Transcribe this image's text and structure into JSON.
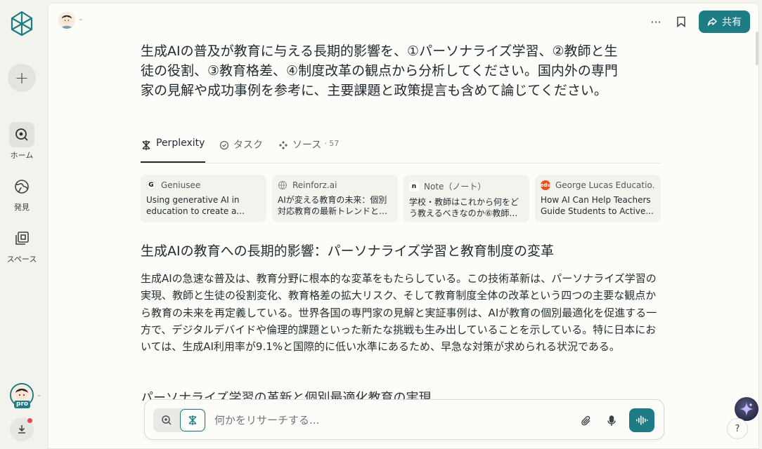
{
  "sidebar": {
    "new_label": "+",
    "items": [
      {
        "label": "ホーム",
        "icon": "home-search-icon",
        "active": true
      },
      {
        "label": "発見",
        "icon": "globe-icon",
        "active": false
      },
      {
        "label": "スペース",
        "icon": "spaces-icon",
        "active": false
      }
    ],
    "pro_badge": "pro"
  },
  "header": {
    "more_label": "···",
    "share_label": "共有"
  },
  "question": "生成AIの普及が教育に与える長期的影響を、①パーソナライズ学習、②教師と生徒の役割、③教育格差、④制度改革の観点から分析してください。国内外の専門家の見解や成功事例を参考に、主要課題と政策提言も含めて論じてください。",
  "tabs": [
    {
      "label": "Perplexity",
      "icon": "perplexity-icon",
      "active": true
    },
    {
      "label": "タスク",
      "icon": "check-circle-icon",
      "active": false
    },
    {
      "label": "ソース",
      "icon": "sources-icon",
      "active": false,
      "count": "· 57"
    }
  ],
  "sources": [
    {
      "site": "Geniusee",
      "favicon": "G",
      "favicon_bg": "#ffffff",
      "favicon_color": "#111111",
      "title": "Using generative AI in education to create a..."
    },
    {
      "site": "Reinforz.ai",
      "favicon": "globe",
      "favicon_bg": "#f3f3ee",
      "favicon_color": "#8a9296",
      "title": "AIが変える教育の未来：個別対応教育の最新トレンドと成..."
    },
    {
      "site": "Note（ノート）",
      "favicon": "n",
      "favicon_bg": "#ffffff",
      "favicon_color": "#111111",
      "title": "学校・教師はこれから何をどう教えるべきなのか⑥教師の..."
    },
    {
      "site": "George Lucas Educatio...",
      "favicon": "edu",
      "favicon_bg": "#e8501f",
      "favicon_color": "#ffffff",
      "title": "How AI Can Help Teachers Guide Students to Active..."
    }
  ],
  "answer": {
    "heading": "生成AIの教育への長期的影響：パーソナライズ学習と教育制度の変革",
    "paragraph": "生成AIの急速な普及は、教育分野に根本的な変革をもたらしている。この技術革新は、パーソナライズ学習の実現、教師と生徒の役割変化、教育格差の拡大リスク、そして教育制度全体の改革という四つの主要な観点から教育の未来を再定義している。世界各国の専門家の見解と実証事例は、AIが教育の個別最適化を促進する一方で、デジタルデバイドや倫理的課題といった新たな挑戦も生み出していることを示している。特に日本においては、生成AI利用率が9.1%と国際的に低い水準にあるため、早急な対策が求められる状況である。",
    "subheading": "パーソナライズ学習の革新と個別最適化教育の実現"
  },
  "input": {
    "placeholder": "何かをリサーチする..."
  },
  "help_label": "?",
  "colors": {
    "accent": "#1d7c84",
    "notification": "#e5484d"
  }
}
